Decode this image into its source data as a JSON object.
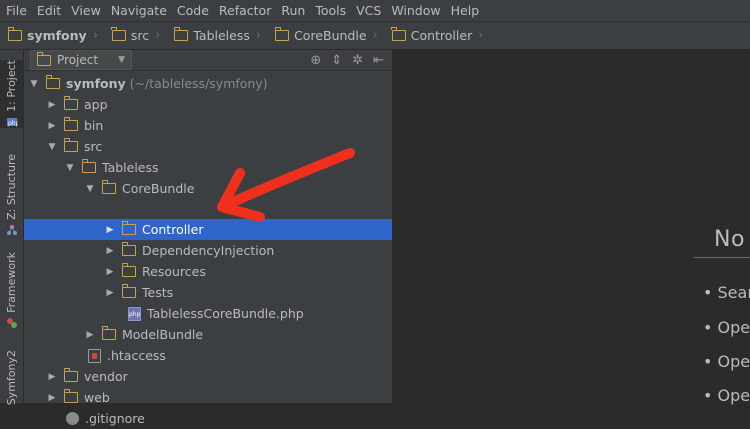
{
  "menu": [
    "File",
    "Edit",
    "View",
    "Navigate",
    "Code",
    "Refactor",
    "Run",
    "Tools",
    "VCS",
    "Window",
    "Help"
  ],
  "breadcrumb": [
    "symfony",
    "src",
    "Tableless",
    "CoreBundle",
    "Controller"
  ],
  "toolstrip": {
    "project": "1: Project",
    "structure": "Z: Structure",
    "framework": "Framework",
    "symfony2": "Symfony2"
  },
  "panel": {
    "title": "Project"
  },
  "tree": [
    {
      "label": "symfony",
      "sub": "(~/tableless/symfony)",
      "icon": "folder",
      "arrow": "down"
    },
    {
      "label": "app",
      "icon": "folder",
      "arrow": "right"
    },
    {
      "label": "bin",
      "icon": "folder",
      "arrow": "right"
    },
    {
      "label": "src",
      "icon": "folder",
      "arrow": "down"
    },
    {
      "label": "Tableless",
      "icon": "folder",
      "arrow": "down"
    },
    {
      "label": "CoreBundle",
      "icon": "folder",
      "arrow": "down"
    },
    {
      "label": "Controller",
      "icon": "folder",
      "arrow": "right",
      "selected": true
    },
    {
      "label": "DependencyInjection",
      "icon": "folder",
      "arrow": "right"
    },
    {
      "label": "Resources",
      "icon": "folder",
      "arrow": "right"
    },
    {
      "label": "Tests",
      "icon": "folder",
      "arrow": "right"
    },
    {
      "label": "TablelessCoreBundle.php",
      "icon": "php",
      "arrow": ""
    },
    {
      "label": "ModelBundle",
      "icon": "folder",
      "arrow": "right"
    },
    {
      "label": ".htaccess",
      "icon": "htaccess",
      "arrow": ""
    },
    {
      "label": "vendor",
      "icon": "folder",
      "arrow": "right"
    },
    {
      "label": "web",
      "icon": "folder",
      "arrow": "right"
    },
    {
      "label": ".gitignore",
      "icon": "git",
      "arrow": ""
    }
  ],
  "editor": {
    "empty_title": "No",
    "tips": [
      "• Sear",
      "• Oper",
      "• Oper",
      "• Oper"
    ]
  },
  "colors": {
    "selection": "#2f65ca",
    "folder": "#c9a24f",
    "arrow_annotation": "#f0301c"
  }
}
